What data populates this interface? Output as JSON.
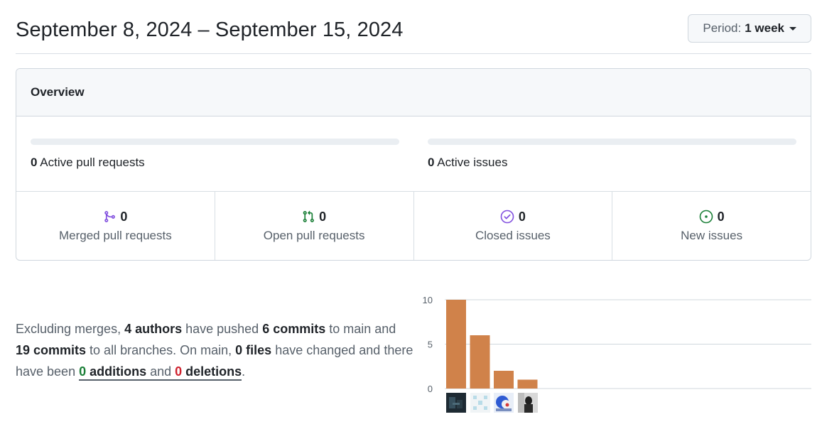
{
  "header": {
    "date_range": "September 8, 2024 – September 15, 2024",
    "period_label": "Period:",
    "period_value": "1 week"
  },
  "overview": {
    "title": "Overview",
    "active_prs_count": "0",
    "active_prs_label": "Active pull requests",
    "active_issues_count": "0",
    "active_issues_label": "Active issues",
    "active_prs_fill": 0,
    "active_issues_fill": 0,
    "stats": [
      {
        "count": "0",
        "label": "Merged pull requests",
        "icon": "merge-icon",
        "color": "#8250df"
      },
      {
        "count": "0",
        "label": "Open pull requests",
        "icon": "pull-request-icon",
        "color": "#1a7f37"
      },
      {
        "count": "0",
        "label": "Closed issues",
        "icon": "issue-closed-icon",
        "color": "#8250df"
      },
      {
        "count": "0",
        "label": "New issues",
        "icon": "issue-opened-icon",
        "color": "#1a7f37"
      }
    ]
  },
  "summary": {
    "t1": "Excluding merges, ",
    "authors": "4 authors",
    "t2": " have pushed ",
    "commits_main": "6 commits",
    "t3": " to main and ",
    "commits_all": "19 commits",
    "t4": " to all branches. On main, ",
    "files": "0 files",
    "t5": " have changed and there have been ",
    "additions_num": "0",
    "additions_word": " additions",
    "and": " and ",
    "deletions_num": "0",
    "deletions_word": " deletions",
    "end": "."
  },
  "chart_data": {
    "type": "bar",
    "categories": [
      "author-1",
      "author-2",
      "author-3",
      "author-4"
    ],
    "values": [
      10,
      6,
      2,
      1
    ],
    "yticks": [
      0,
      5,
      10
    ],
    "ylim": [
      0,
      10
    ],
    "bar_color": "#d0824a",
    "title": "",
    "xlabel": "",
    "ylabel": ""
  }
}
